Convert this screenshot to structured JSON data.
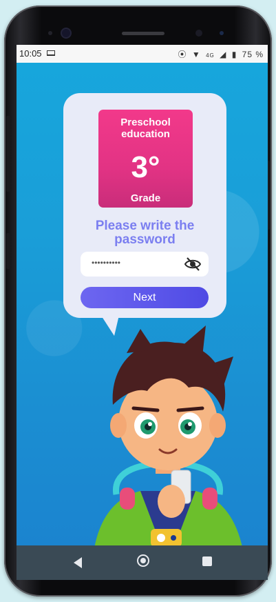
{
  "statusbar": {
    "time": "10:05",
    "network": "4G",
    "battery": "75 %"
  },
  "card": {
    "title_line1": "Preschool",
    "title_line2": "education",
    "grade_number": "3°",
    "grade_label": "Grade"
  },
  "prompt": {
    "line1": "Please write the",
    "line2": "password"
  },
  "password_field": {
    "value": "••••••••••"
  },
  "next_button": {
    "label": "Next"
  },
  "colors": {
    "accent": "#7b7ff0",
    "card": "#e23384",
    "button": "#5b56ea",
    "background": "#1aa8dc"
  }
}
